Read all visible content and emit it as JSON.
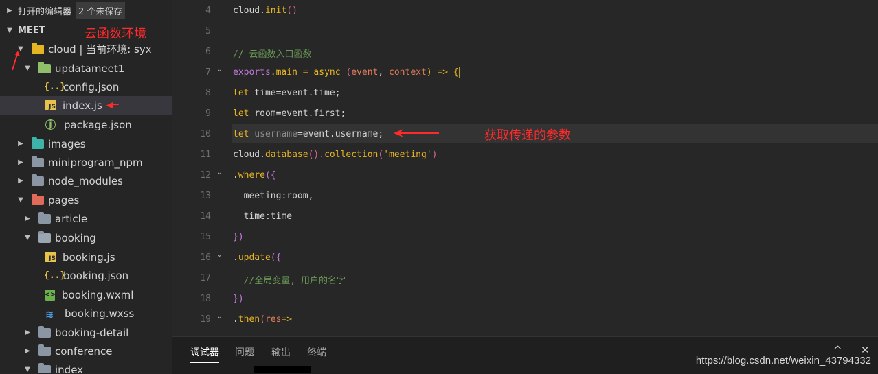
{
  "sidebar": {
    "open_editors_label": "打开的编辑器",
    "unsaved_badge": "2 个未保存",
    "project_name": "MEET",
    "annotation_env": "云函数环境",
    "items": [
      {
        "label": "cloud | 当前环境: syx",
        "icon": "folder-yellow-open-icon"
      },
      {
        "label": "updatameet1",
        "icon": "folder-green-icon"
      },
      {
        "label": "config.json",
        "icon": "json-file-icon"
      },
      {
        "label": "index.js",
        "icon": "js-file-icon"
      },
      {
        "label": "package.json",
        "icon": "npm-package-icon"
      },
      {
        "label": "images",
        "icon": "folder-teal-icon"
      },
      {
        "label": "miniprogram_npm",
        "icon": "folder-icon"
      },
      {
        "label": "node_modules",
        "icon": "folder-icon"
      },
      {
        "label": "pages",
        "icon": "folder-red-icon"
      },
      {
        "label": "article",
        "icon": "folder-icon"
      },
      {
        "label": "booking",
        "icon": "folder-open-icon"
      },
      {
        "label": "booking.js",
        "icon": "js-file-icon"
      },
      {
        "label": "booking.json",
        "icon": "json-file-icon"
      },
      {
        "label": "booking.wxml",
        "icon": "wxml-file-icon"
      },
      {
        "label": "booking.wxss",
        "icon": "wxss-file-icon"
      },
      {
        "label": "booking-detail",
        "icon": "folder-icon"
      },
      {
        "label": "conference",
        "icon": "folder-icon"
      },
      {
        "label": "index",
        "icon": "folder-icon"
      }
    ]
  },
  "editor": {
    "line_numbers": [
      "4",
      "5",
      "6",
      "7",
      "8",
      "9",
      "10",
      "11",
      "12",
      "13",
      "14",
      "15",
      "16",
      "17",
      "18",
      "19"
    ],
    "annotation_params": "获取传递的参数",
    "lines": {
      "l4_a": "cloud.",
      "l4_b": "init",
      "l4_c": "()",
      "l6": "// 云函数入口函数",
      "l7_a": "exports",
      "l7_b": ".main",
      "l7_c": " = ",
      "l7_d": "async",
      "l7_e": " (",
      "l7_f": "event",
      "l7_g": ", ",
      "l7_h": "context",
      "l7_i": ") => ",
      "l7_j": "{",
      "l8_a": "let",
      "l8_b": " time=event.time;",
      "l9_a": "let",
      "l9_b": " room=event.first;",
      "l10_a": "let",
      "l10_b": " username",
      "l10_c": "=event.username;",
      "l11_a": "cloud.",
      "l11_b": "database",
      "l11_c": "().",
      "l11_d": "collection",
      "l11_e": "(",
      "l11_f": "'meeting'",
      "l11_g": ")",
      "l12_a": ".",
      "l12_b": "where",
      "l12_c": "({",
      "l13_a": "  meeting",
      "l13_b": ":room,",
      "l14_a": "  time",
      "l14_b": ":time",
      "l15": "})",
      "l16_a": ".",
      "l16_b": "update",
      "l16_c": "({",
      "l17": "  //全局变量, 用户的名字",
      "l18": "})",
      "l19_a": ".",
      "l19_b": "then",
      "l19_c": "(",
      "l19_d": "res",
      "l19_e": "=>"
    }
  },
  "panel": {
    "tabs": [
      "调试器",
      "问题",
      "输出",
      "终端"
    ],
    "active_tab": "调试器",
    "ctrl_up": "^",
    "ctrl_close": "✕"
  },
  "watermark": "https://blog.csdn.net/weixin_43794332"
}
